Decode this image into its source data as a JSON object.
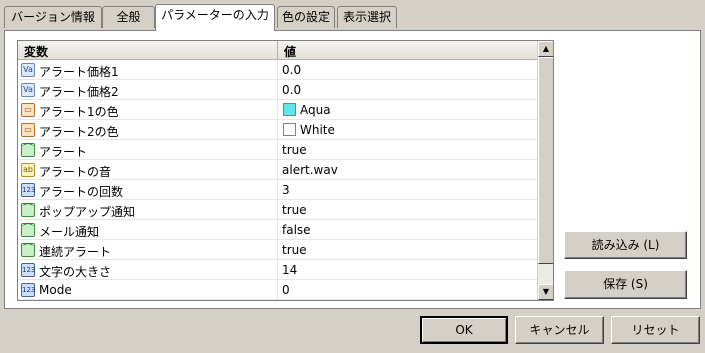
{
  "tabs": [
    "バージョン情報",
    "全般",
    "パラメーターの入力",
    "色の設定",
    "表示選択"
  ],
  "active_tab": 2,
  "grid": {
    "col_variable": "変数",
    "col_value": "値",
    "rows": [
      {
        "icon": "double-icon",
        "icon_text": "Va",
        "name": "アラート価格1",
        "value": "0.0"
      },
      {
        "icon": "double-icon",
        "icon_text": "Va",
        "name": "アラート価格2",
        "value": "0.0"
      },
      {
        "icon": "color-icon",
        "icon_text": "▭",
        "name": "アラート1の色",
        "value": "Aqua",
        "swatch": "#5fe6ea"
      },
      {
        "icon": "color-icon",
        "icon_text": "▭",
        "name": "アラート2の色",
        "value": "White",
        "swatch": "#ffffff"
      },
      {
        "icon": "bool-icon",
        "icon_text": "⌒",
        "name": "アラート",
        "value": "true"
      },
      {
        "icon": "string-icon",
        "icon_text": "ab",
        "name": "アラートの音",
        "value": "alert.wav"
      },
      {
        "icon": "int-icon",
        "icon_text": "123",
        "name": "アラートの回数",
        "value": "3"
      },
      {
        "icon": "bool-icon",
        "icon_text": "⌒",
        "name": "ポップアップ通知",
        "value": "true"
      },
      {
        "icon": "bool-icon",
        "icon_text": "⌒",
        "name": "メール通知",
        "value": "false"
      },
      {
        "icon": "bool-icon",
        "icon_text": "⌒",
        "name": "連続アラート",
        "value": "true"
      },
      {
        "icon": "int-icon",
        "icon_text": "123",
        "name": "文字の大きさ",
        "value": "14"
      },
      {
        "icon": "int-icon",
        "icon_text": "123",
        "name": "Mode",
        "value": "0"
      }
    ]
  },
  "buttons": {
    "load": "読み込み (L)",
    "save": "保存 (S)",
    "ok": "OK",
    "cancel": "キャンセル",
    "reset": "リセット"
  }
}
